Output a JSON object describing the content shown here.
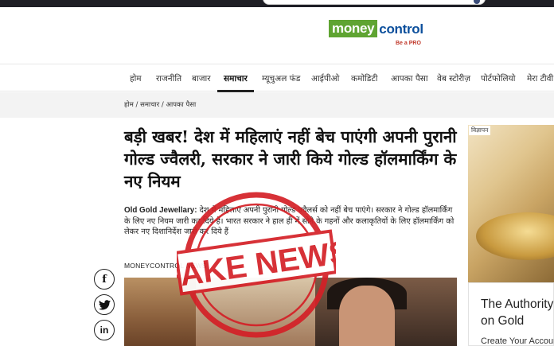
{
  "header": {
    "logo_money": "money",
    "logo_control": "control",
    "tagline": "Be a PRO"
  },
  "nav": {
    "items": [
      "होम",
      "राजनीति",
      "बाजार",
      "समाचार",
      "म्यूचुअल फंड",
      "आईपीओ",
      "कमोडिटी",
      "आपका पैसा",
      "वेब स्टोरीज़",
      "पोर्टफोलियो",
      "मेरा टीवी"
    ],
    "active": "समाचार"
  },
  "breadcrumb": {
    "home": "होम",
    "sep1": "/",
    "news": "समाचार",
    "sep2": "/",
    "section": "आपका पैसा"
  },
  "article": {
    "headline": "बड़ी खबर! देश में महिलाएं नहीं बेच पाएंगी अपनी पुरानी गोल्ड ज्वैलरी, सरकार ने जारी किये गोल्ड हॉलमार्किंग के नए नियम",
    "summary_lead": "Old Gold Jewellary:",
    "summary": "देश में महिलाएं अपनी पुरानी गोल्ड ज्वैलर्स को नहीं बेच पाएंगे। सरकार ने गोल्ड हॉलमार्किंग के लिए नए नियम जारी कर दिये हैं। भारत सरकार ने हाल ही में सोने के गहनों और कलाकृतियों के लिए हॉलमार्किंग को लेकर नए दिशानिर्देश जारी कर दिये हैं",
    "author": "MONEYCONTROL NEWS"
  },
  "share": {
    "facebook": "f",
    "linkedin": "in"
  },
  "ad": {
    "tag": "विज्ञापन",
    "title": "The Authority on Gold",
    "cta": "Create Your Account"
  },
  "stamp": {
    "text": "FAKE NEWS"
  },
  "colors": {
    "logo_green": "#5fa432",
    "logo_blue": "#0b4f9c",
    "stamp_red": "#d42027"
  }
}
